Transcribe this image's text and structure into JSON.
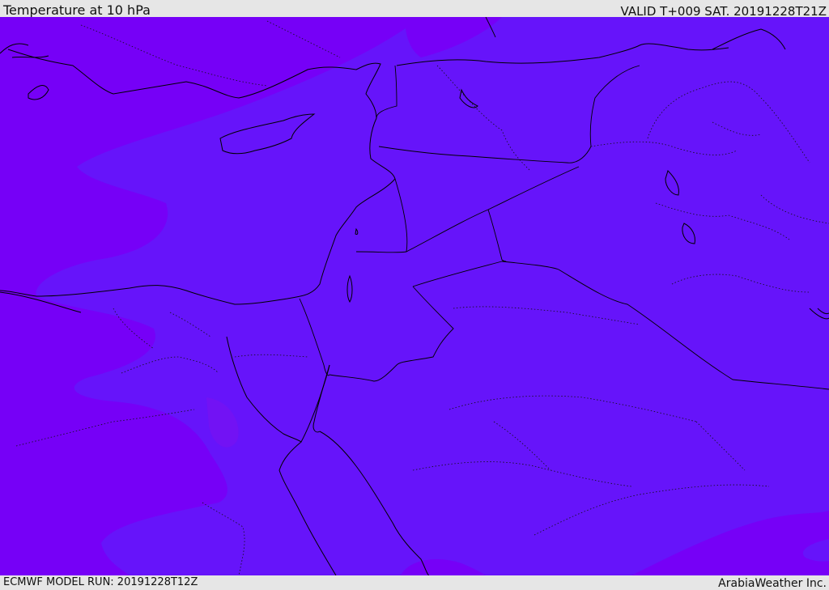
{
  "header": {
    "title": "Temperature at 10 hPa",
    "valid": "VALID T+009 SAT. 20191228T21Z"
  },
  "footer": {
    "model_run": "ECMWF MODEL RUN: 20191228T12Z",
    "brand": "ArabiaWeather Inc."
  },
  "colors": {
    "field_warm_band": "#6614fa",
    "field_cold_band": "#7600f7",
    "coastline": "#000000",
    "header_bg": "#e6e6e6"
  }
}
